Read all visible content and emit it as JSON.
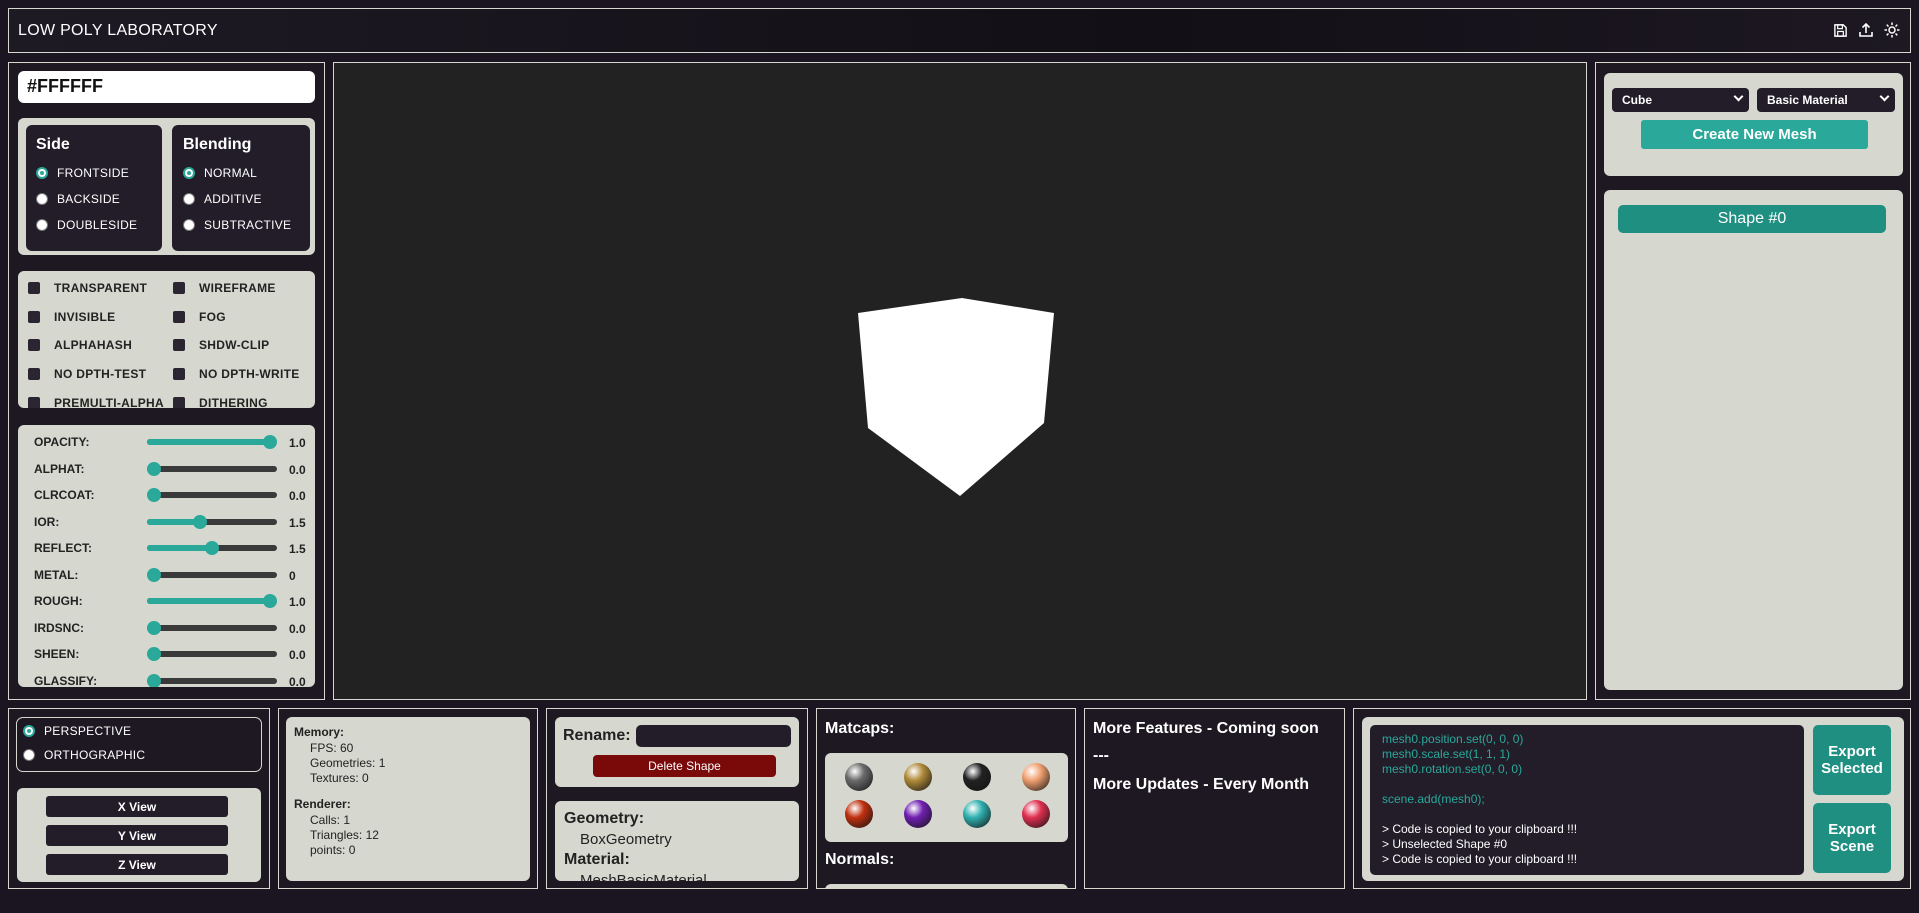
{
  "app": {
    "title": "LOW POLY LABORATORY"
  },
  "header_icons": [
    "save-icon",
    "upload-icon",
    "sun-icon"
  ],
  "color": {
    "hex": "#FFFFFF"
  },
  "side": {
    "heading": "Side",
    "options": [
      "FRONTSIDE",
      "BACKSIDE",
      "DOUBLESIDE"
    ],
    "selected": "FRONTSIDE"
  },
  "blending": {
    "heading": "Blending",
    "options": [
      "NORMAL",
      "ADDITIVE",
      "SUBTRACTIVE"
    ],
    "selected": "NORMAL"
  },
  "flags": {
    "items": [
      "TRANSPARENT",
      "WIREFRAME",
      "INVISIBLE",
      "FOG",
      "ALPHAHASH",
      "SHDW-CLIP",
      "NO DPTH-TEST",
      "NO DPTH-WRITE",
      "PREMULTI-ALPHA",
      "DITHERING"
    ]
  },
  "sliders": [
    {
      "label": "OPACITY:",
      "value": "1.0",
      "fraction": 1.0
    },
    {
      "label": "ALPHAT:",
      "value": "0.0",
      "fraction": 0.0
    },
    {
      "label": "CLRCOAT:",
      "value": "0.0",
      "fraction": 0.0
    },
    {
      "label": "IOR:",
      "value": "1.5",
      "fraction": 0.4
    },
    {
      "label": "REFLECT:",
      "value": "1.5",
      "fraction": 0.5
    },
    {
      "label": "METAL:",
      "value": "0",
      "fraction": 0.0
    },
    {
      "label": "ROUGH:",
      "value": "1.0",
      "fraction": 1.0
    },
    {
      "label": "IRDSNC:",
      "value": "0.0",
      "fraction": 0.0
    },
    {
      "label": "SHEEN:",
      "value": "0.0",
      "fraction": 0.0
    },
    {
      "label": "GLASSIFY:",
      "value": "0.0",
      "fraction": 0.0
    }
  ],
  "mesh": {
    "geometry_select": "Cube",
    "material_select": "Basic Material",
    "create_label": "Create New Mesh"
  },
  "shapes": [
    "Shape #0"
  ],
  "camera": {
    "options": [
      "PERSPECTIVE",
      "ORTHOGRAPHIC"
    ],
    "selected": "PERSPECTIVE"
  },
  "views": [
    "X View",
    "Y View",
    "Z View"
  ],
  "memory": {
    "heading": "Memory:",
    "fps": "FPS: 60",
    "geometries": "Geometries: 1",
    "textures": "Textures: 0"
  },
  "renderer": {
    "heading": "Renderer:",
    "calls": "Calls: 1",
    "triangles": "Triangles: 12",
    "points": "points: 0"
  },
  "rename": {
    "label": "Rename:",
    "value": "",
    "delete_label": "Delete Shape"
  },
  "info": {
    "geometry_label": "Geometry:",
    "geometry_value": "BoxGeometry",
    "material_label": "Material:",
    "material_value": "MeshBasicMaterial"
  },
  "matcaps": {
    "heading": "Matcaps:",
    "balls": [
      "#6a6a6a",
      "#b08a3a",
      "#222222",
      "#f0a070",
      "#c03010",
      "#7020b0",
      "#30b0b0",
      "#e03050"
    ]
  },
  "normals": {
    "heading": "Normals:"
  },
  "features": {
    "line1": "More Features - Coming soon",
    "line2": "---",
    "line3": "More Updates - Every Month"
  },
  "code": {
    "lines": [
      "mesh0.position.set(0, 0, 0)",
      "mesh0.scale.set(1, 1, 1)",
      "mesh0.rotation.set(0, 0, 0)",
      "",
      "scene.add(mesh0);"
    ],
    "log": [
      "> Code is copied to your clipboard !!!",
      "> Unselected Shape #0",
      "> Code is copied to your clipboard !!!"
    ]
  },
  "export": {
    "selected_line1": "Export",
    "selected_line2": "Selected",
    "scene_line1": "Export",
    "scene_line2": "Scene"
  },
  "colors": {
    "accent": "#2aa89a",
    "delete": "#7a0a0a",
    "panel": "#d6d8d0",
    "dark": "#221d29"
  }
}
